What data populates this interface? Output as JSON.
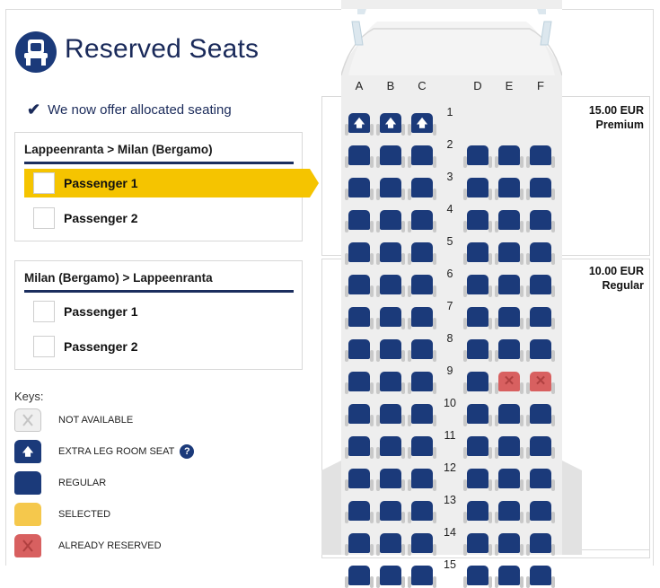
{
  "header": {
    "title": "Reserved Seats",
    "logo_icon": "seat-icon"
  },
  "offer": {
    "text": "We now offer allocated seating"
  },
  "routes": [
    {
      "title": "Lappeenranta > Milan (Bergamo)",
      "passengers": [
        {
          "label": "Passenger 1",
          "active": true
        },
        {
          "label": "Passenger 2",
          "active": false
        }
      ]
    },
    {
      "title": "Milan (Bergamo) > Lappeenranta",
      "passengers": [
        {
          "label": "Passenger 1",
          "active": false
        },
        {
          "label": "Passenger 2",
          "active": false
        }
      ]
    }
  ],
  "keys": {
    "title": "Keys:",
    "items": [
      {
        "label": "NOT AVAILABLE",
        "type": "na"
      },
      {
        "label": "EXTRA LEG ROOM SEAT",
        "type": "extra",
        "help": "?"
      },
      {
        "label": "REGULAR",
        "type": "regular"
      },
      {
        "label": "SELECTED",
        "type": "selected"
      },
      {
        "label": "ALREADY RESERVED",
        "type": "reserved"
      }
    ]
  },
  "prices": [
    {
      "amount": "15.00 EUR",
      "tier": "Premium"
    },
    {
      "amount": "10.00 EUR",
      "tier": "Regular"
    }
  ],
  "seatmap": {
    "columns": [
      "A",
      "B",
      "C",
      "D",
      "E",
      "F"
    ],
    "rows": [
      1,
      2,
      3,
      4,
      5,
      6,
      7,
      8,
      9,
      10,
      11,
      12,
      13,
      14,
      15
    ],
    "row1_left_only": true,
    "extra_legroom_rows": [
      1
    ],
    "reserved": [
      "9E",
      "9F"
    ],
    "colors": {
      "regular": "#1b3a7a",
      "reserved": "#d86060",
      "selected": "#f5c84c",
      "not_available": "#efefef"
    }
  }
}
